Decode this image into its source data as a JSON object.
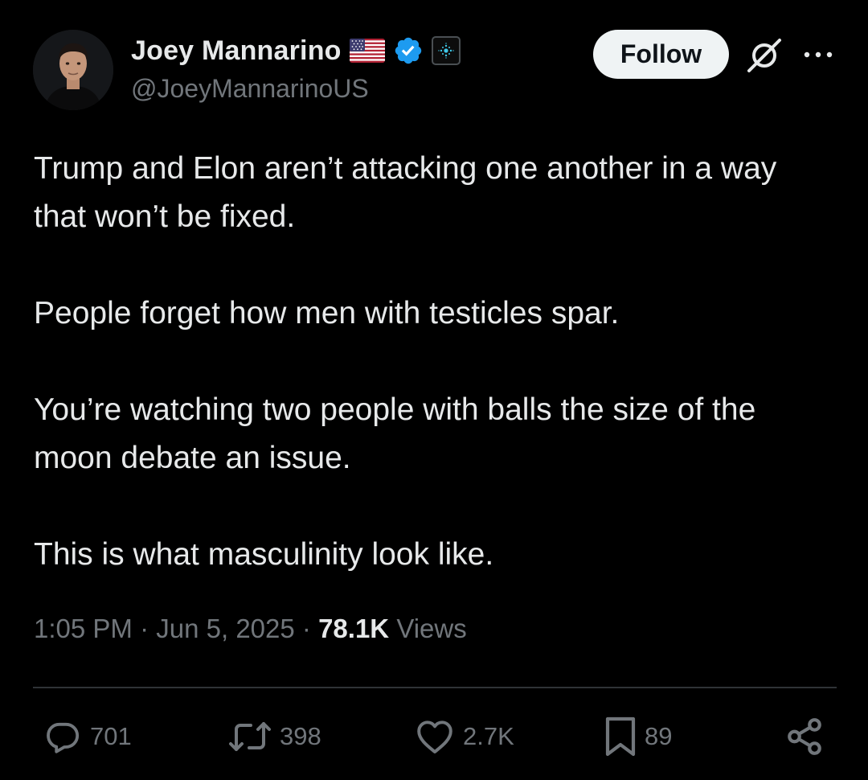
{
  "author": {
    "display_name": "Joey Mannarino",
    "handle": "@JoeyMannarinoUS",
    "flag_icon": "us-flag-icon",
    "verified_icon": "verified-badge-icon",
    "affiliation_icon": "affiliate-badge-icon"
  },
  "header": {
    "follow_label": "Follow",
    "grok_icon": "grok-icon",
    "more_icon": "more-dots-icon"
  },
  "tweet": {
    "paragraphs": [
      "Trump and Elon aren’t attacking one another in a way that won’t be fixed.",
      "People forget how men with testicles spar.",
      "You’re watching two people with balls the size of the moon debate an issue.",
      "This is what masculinity look like."
    ]
  },
  "meta": {
    "time": "1:05 PM",
    "separator": "·",
    "date": "Jun 5, 2025",
    "views_count": "78.1K",
    "views_label": "Views"
  },
  "actions": {
    "replies": "701",
    "reposts": "398",
    "likes": "2.7K",
    "bookmarks": "89"
  },
  "colors": {
    "background": "#000000",
    "text_primary": "#e7e9ea",
    "text_secondary": "#71767b",
    "verified_blue": "#1d9bf0",
    "divider": "#2f3336",
    "follow_bg": "#eff3f4"
  }
}
